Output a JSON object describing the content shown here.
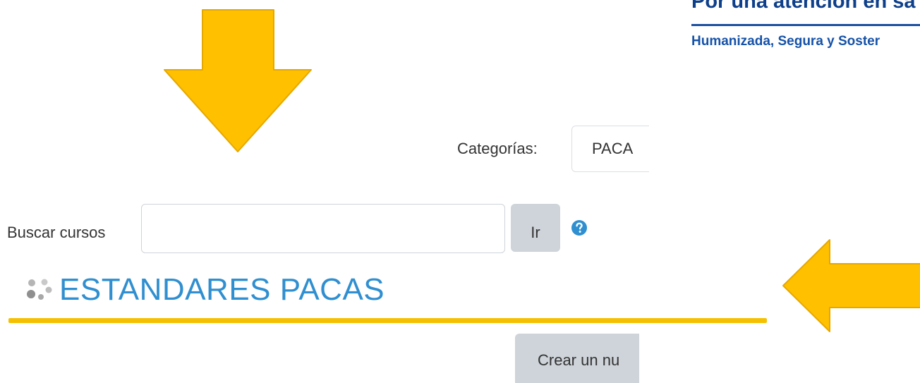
{
  "banner": {
    "line1": "Por una atención en sa",
    "line2": "Humanizada, Segura y Soster"
  },
  "categories": {
    "label": "Categorías:",
    "selected": "PACA"
  },
  "search": {
    "label": "Buscar cursos",
    "value": "",
    "placeholder": "",
    "button_label": "Ir"
  },
  "icons": {
    "help": "help-circle-icon",
    "category": "category-nodes-icon",
    "arrow_down": "arrow-down-icon",
    "arrow_left": "arrow-left-icon"
  },
  "category_title": "ESTANDARES PACAS",
  "create_button_label": "Crear un nu",
  "colors": {
    "arrow_fill": "#ffc000",
    "arrow_stroke": "#e5a800",
    "title": "#2f8fd0",
    "underline": "#f5c000",
    "help_icon": "#2f8fd0",
    "banner_text": "#0e3f8a"
  }
}
